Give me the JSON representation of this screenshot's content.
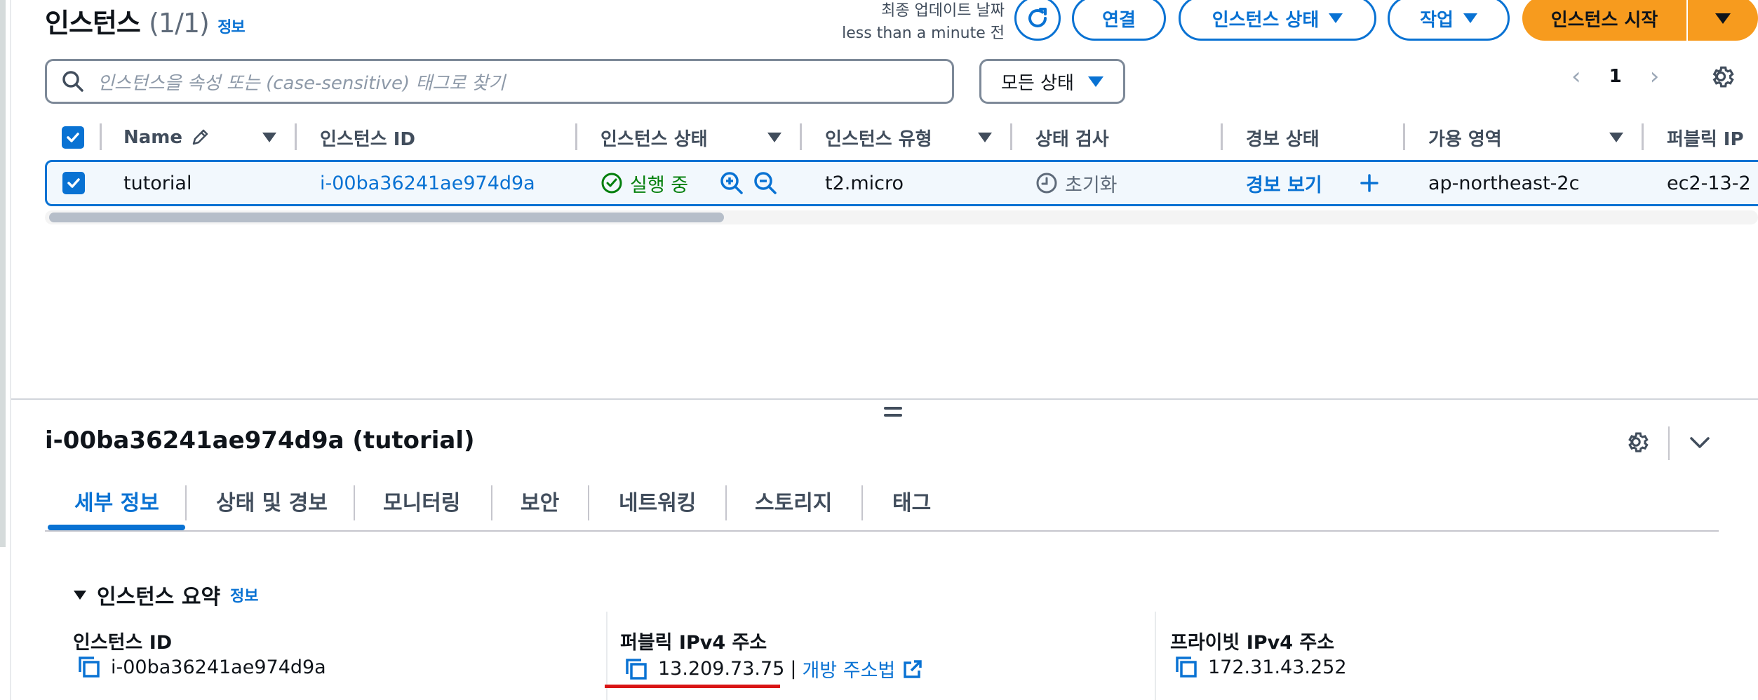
{
  "header": {
    "title": "인스턴스",
    "count": "(1/1)",
    "info_link": "정보",
    "last_updated_label": "최종 업데이트 날짜",
    "last_updated_value": "less than a minute 전",
    "connect_label": "연결",
    "instance_state_label": "인스턴스 상태",
    "actions_label": "작업",
    "launch_label": "인스턴스 시작"
  },
  "search": {
    "placeholder": "인스턴스을 속성 또는 (case-sensitive) 태그로 찾기"
  },
  "state_filter": {
    "label": "모든 상태"
  },
  "pagination": {
    "current_page": "1"
  },
  "table": {
    "columns": [
      "Name",
      "인스턴스 ID",
      "인스턴스 상태",
      "인스턴스 유형",
      "상태 검사",
      "경보 상태",
      "가용 영역",
      "퍼블릭 IP"
    ],
    "rows": [
      {
        "name": "tutorial",
        "instance_id": "i-00ba36241ae974d9a",
        "state": "실행 중",
        "type": "t2.micro",
        "status_check": "초기화",
        "alarm": "경보 보기",
        "az": "ap-northeast-2c",
        "public_dns": "ec2-13-2"
      }
    ]
  },
  "details": {
    "title": "i-00ba36241ae974d9a (tutorial)",
    "tabs": [
      "세부 정보",
      "상태 및 경보",
      "모니터링",
      "보안",
      "네트워킹",
      "스토리지",
      "태그"
    ],
    "summary_heading": "인스턴스 요약",
    "summary_info": "정보",
    "fields": {
      "instance_id_label": "인스턴스 ID",
      "instance_id_value": "i-00ba36241ae974d9a",
      "public_ipv4_label": "퍼블릭 IPv4 주소",
      "public_ipv4_value": "13.209.73.75",
      "open_address_link": "개방 주소법",
      "private_ipv4_label": "프라이빗 IPv4 주소",
      "private_ipv4_value": "172.31.43.252"
    }
  },
  "colors": {
    "primary_blue": "#0972d3",
    "launch_orange": "#f79b1e",
    "success_green": "#037f0c",
    "highlight_red": "#d91515"
  }
}
